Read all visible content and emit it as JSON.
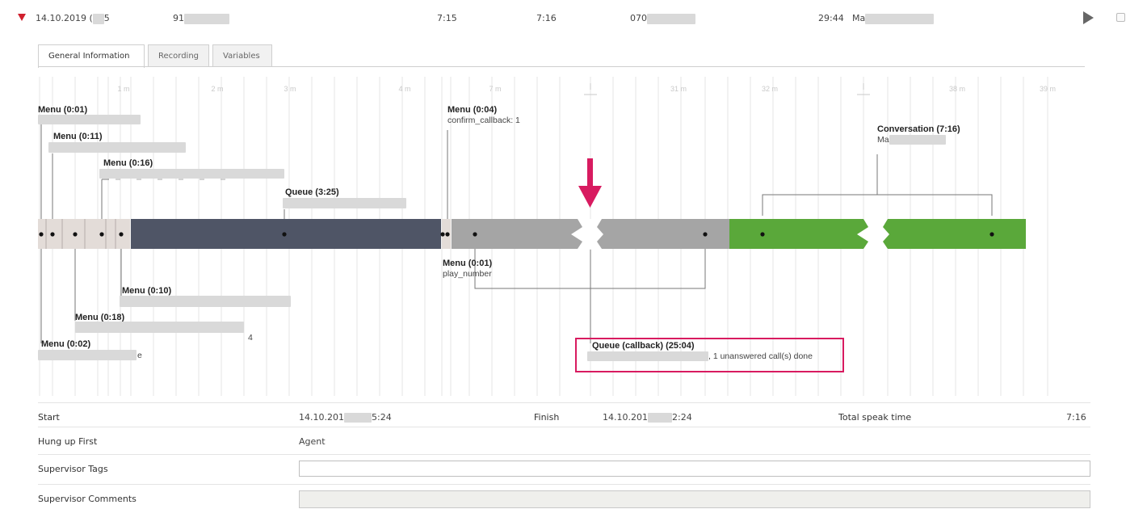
{
  "row": {
    "date": "14.10.2019 (",
    "date_tail": "5",
    "number_prefix": "91",
    "duration_a": "7:15",
    "duration_b": "7:16",
    "number2_prefix": "070",
    "time": "29:44",
    "name_prefix": "Ma"
  },
  "tabs": [
    "General Information",
    "Recording",
    "Variables"
  ],
  "timeline": {
    "minute_ticks": [
      "1 m",
      "2 m",
      "3 m",
      "4 m",
      "7 m",
      "31 m",
      "32 m",
      "38 m",
      "39 m"
    ],
    "labels": {
      "menu_001": "Menu (0:01)",
      "menu_011": "Menu (0:11)",
      "menu_016": "Menu (0:16)",
      "queue_325": "Queue (3:25)",
      "menu_004": "Menu (0:04)",
      "menu_004_sub": "confirm_callback: 1",
      "conversation": "Conversation (7:16)",
      "conversation_sub": "Ma",
      "menu_001b": "Menu (0:01)",
      "menu_001b_sub": "play_number",
      "menu_010": "Menu (0:10)",
      "menu_018": "Menu (0:18)",
      "menu_018_tail": "4",
      "menu_002": "Menu (0:02)",
      "menu_002_tail": "e",
      "queue_callback": "Queue (callback) (25:04)",
      "queue_callback_sub": ", 1 unanswered call(s) done"
    },
    "colors": {
      "menu_segment": "#e3dcd8",
      "queue_segment": "#4f5566",
      "callback_segment": "#a5a5a5",
      "conversation_segment": "#5aa83a",
      "highlight": "#d81b60"
    }
  },
  "info": {
    "start_label": "Start",
    "start_value": "14.10.201",
    "start_value_tail": "5:24",
    "finish_label": "Finish",
    "finish_value": "14.10.201",
    "finish_value_tail": "2:24",
    "speak_label": "Total speak time",
    "speak_value": "7:16",
    "hungup_label": "Hung up First",
    "hungup_value": "Agent",
    "tags_label": "Supervisor Tags",
    "tags_value": "",
    "comments_label": "Supervisor Comments",
    "comments_value": ""
  }
}
